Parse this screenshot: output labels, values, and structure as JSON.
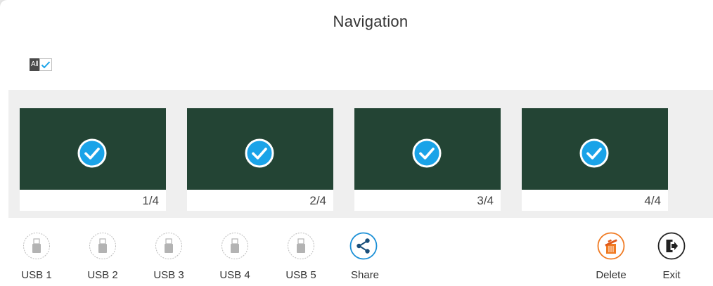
{
  "header": {
    "title": "Navigation"
  },
  "select_all": {
    "label": "All",
    "checked": true
  },
  "colors": {
    "thumbnail": "#234434",
    "check_fill": "#1aa3e8",
    "share_accent": "#1a8fd6",
    "delete_accent": "#f07a22",
    "disabled": "#b3b3b3"
  },
  "pages": [
    {
      "label": "1/4",
      "selected": true
    },
    {
      "label": "2/4",
      "selected": true
    },
    {
      "label": "3/4",
      "selected": true
    },
    {
      "label": "4/4",
      "selected": true
    }
  ],
  "toolbar": {
    "usb": [
      {
        "label": "USB 1",
        "icon": "usb-drive-icon",
        "enabled": false
      },
      {
        "label": "USB 2",
        "icon": "usb-drive-icon",
        "enabled": false
      },
      {
        "label": "USB 3",
        "icon": "usb-drive-icon",
        "enabled": false
      },
      {
        "label": "USB 4",
        "icon": "usb-drive-icon",
        "enabled": false
      },
      {
        "label": "USB 5",
        "icon": "usb-drive-icon",
        "enabled": false
      }
    ],
    "share": {
      "label": "Share",
      "icon": "share-icon"
    },
    "delete": {
      "label": "Delete",
      "icon": "trash-icon"
    },
    "exit": {
      "label": "Exit",
      "icon": "exit-icon"
    }
  }
}
